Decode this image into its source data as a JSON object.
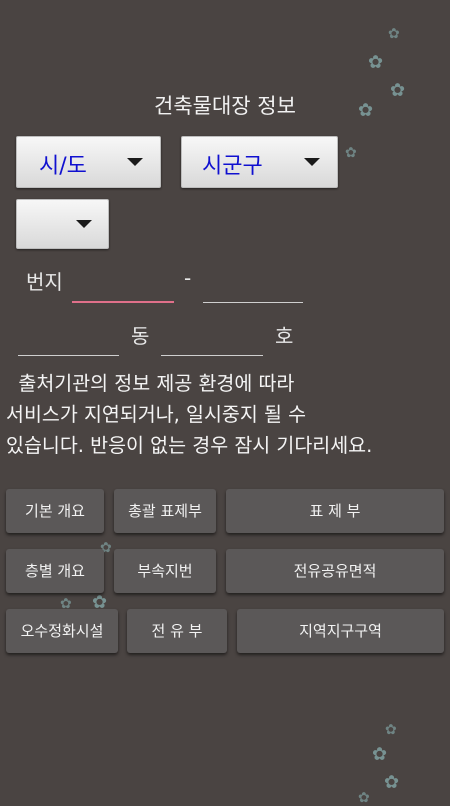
{
  "title": "건축물대장 정보",
  "sido_spinner": {
    "label": "시/도"
  },
  "sigungu_spinner": {
    "label": "시군구"
  },
  "dong_spinner": {
    "label": ""
  },
  "address": {
    "bunji_label": "번지",
    "dash": "-",
    "dong_label": "동",
    "ho_label": "호"
  },
  "notice": "  출처기관의 정보 제공 환경에 따라\n서비스가 지연되거나, 일시중지 될 수\n있습니다. 반응이 없는 경우 잠시 기다리세요.",
  "buttons": {
    "basic_overview": "기본 개요",
    "general_title": "총괄 표제부",
    "title_section": "표 제 부",
    "floor_overview": "층별 개요",
    "annex_lot": "부속지번",
    "exclusive_common_area": "전유공유면적",
    "sewage_facility": "오수정화시설",
    "exclusive_section": "전 유 부",
    "zoning_area": "지역지구구역"
  },
  "colors": {
    "background": "#4a4442",
    "button": "#5b5858",
    "spinner_text": "#1010d0",
    "active_underline": "#e0708a"
  }
}
